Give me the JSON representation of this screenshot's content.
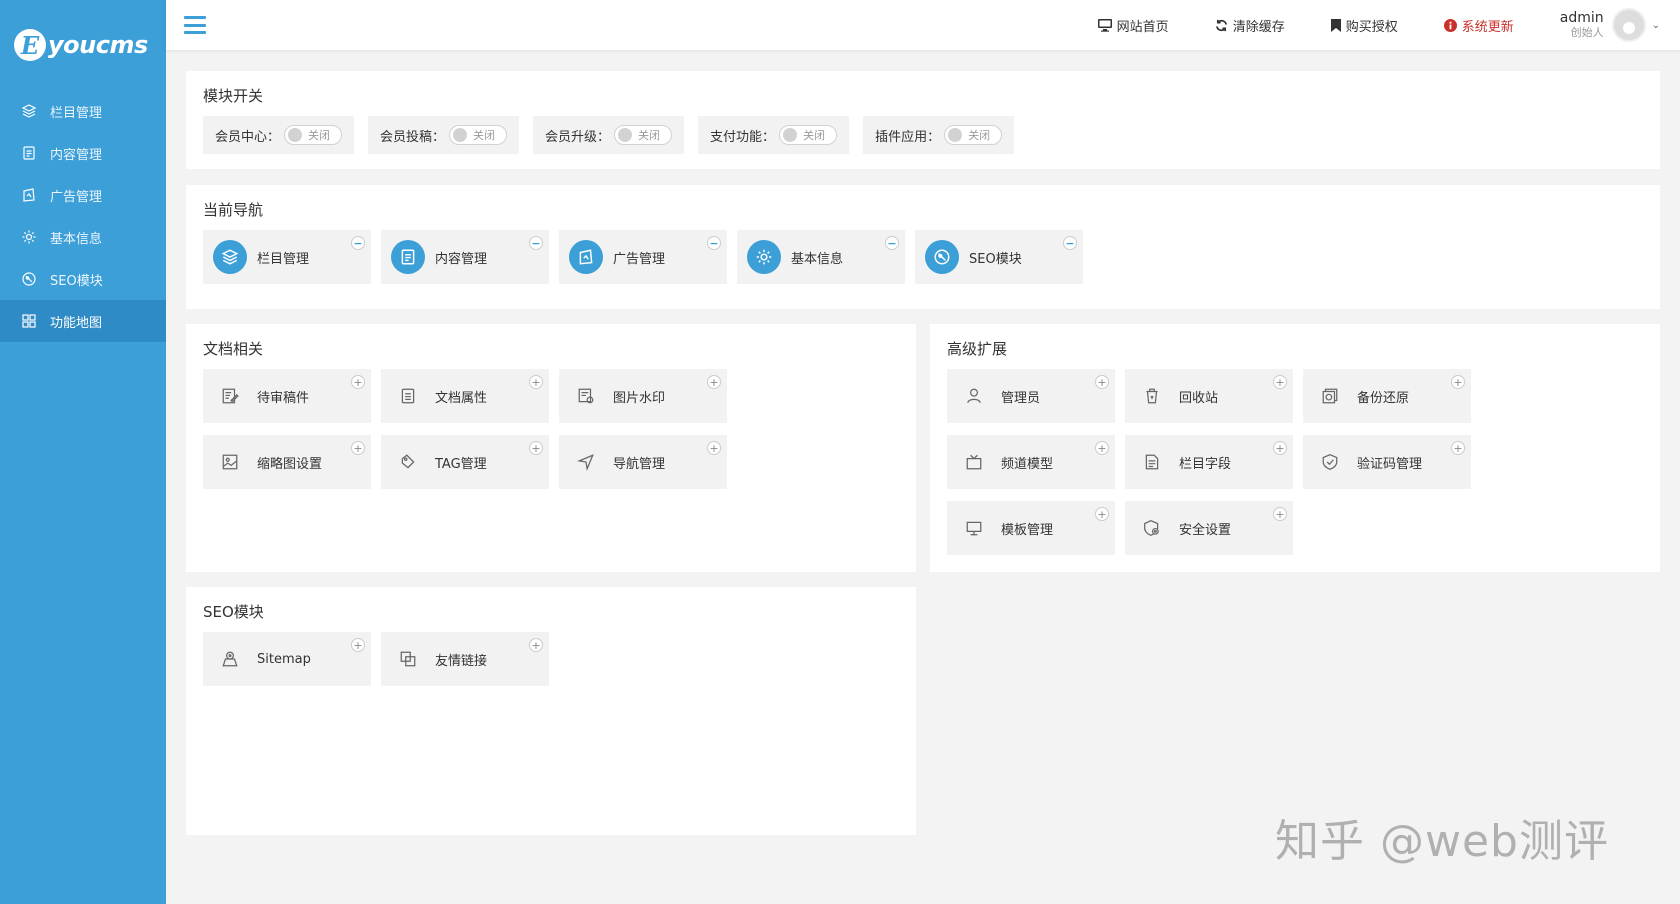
{
  "brand": {
    "logo_letter": "E",
    "logo_text": "youcms"
  },
  "sidebar": {
    "items": [
      {
        "label": "栏目管理",
        "icon": "layers-icon"
      },
      {
        "label": "内容管理",
        "icon": "document-icon"
      },
      {
        "label": "广告管理",
        "icon": "ad-icon"
      },
      {
        "label": "基本信息",
        "icon": "gear-icon"
      },
      {
        "label": "SEO模块",
        "icon": "seo-icon"
      },
      {
        "label": "功能地图",
        "icon": "grid-icon",
        "active": true
      }
    ]
  },
  "header": {
    "links": [
      {
        "label": "网站首页",
        "icon": "monitor-icon"
      },
      {
        "label": "清除缓存",
        "icon": "refresh-icon"
      },
      {
        "label": "购买授权",
        "icon": "bookmark-icon"
      },
      {
        "label": "系统更新",
        "icon": "info-icon",
        "color": "#c9302c"
      }
    ],
    "user": {
      "name": "admin",
      "role": "创始人"
    }
  },
  "module_switch": {
    "title": "模块开关",
    "items": [
      {
        "label": "会员中心：",
        "state": "关闭"
      },
      {
        "label": "会员投稿：",
        "state": "关闭"
      },
      {
        "label": "会员升级：",
        "state": "关闭"
      },
      {
        "label": "支付功能：",
        "state": "关闭"
      },
      {
        "label": "插件应用：",
        "state": "关闭"
      }
    ]
  },
  "current_nav": {
    "title": "当前导航",
    "items": [
      {
        "label": "栏目管理",
        "icon": "layers-icon",
        "badge": "−"
      },
      {
        "label": "内容管理",
        "icon": "document-icon",
        "badge": "−"
      },
      {
        "label": "广告管理",
        "icon": "ad-icon",
        "badge": "−"
      },
      {
        "label": "基本信息",
        "icon": "gear-icon",
        "badge": "−"
      },
      {
        "label": "SEO模块",
        "icon": "seo-icon",
        "badge": "−"
      }
    ]
  },
  "doc_related": {
    "title": "文档相关",
    "items": [
      {
        "label": "待审稿件",
        "icon": "edit-icon",
        "badge": "+"
      },
      {
        "label": "文档属性",
        "icon": "list-doc-icon",
        "badge": "+"
      },
      {
        "label": "图片水印",
        "icon": "watermark-icon",
        "badge": "+"
      },
      {
        "label": "缩略图设置",
        "icon": "image-icon",
        "badge": "+"
      },
      {
        "label": "TAG管理",
        "icon": "tag-icon",
        "badge": "+"
      },
      {
        "label": "导航管理",
        "icon": "navigation-icon",
        "badge": "+"
      }
    ]
  },
  "advanced": {
    "title": "高级扩展",
    "items": [
      {
        "label": "管理员",
        "icon": "user-icon",
        "badge": "+"
      },
      {
        "label": "回收站",
        "icon": "trash-icon",
        "badge": "+"
      },
      {
        "label": "备份还原",
        "icon": "backup-icon",
        "badge": "+"
      },
      {
        "label": "频道模型",
        "icon": "tv-icon",
        "badge": "+"
      },
      {
        "label": "栏目字段",
        "icon": "field-icon",
        "badge": "+"
      },
      {
        "label": "验证码管理",
        "icon": "shield-icon",
        "badge": "+"
      },
      {
        "label": "模板管理",
        "icon": "monitor-icon",
        "badge": "+"
      },
      {
        "label": "安全设置",
        "icon": "security-icon",
        "badge": "+"
      }
    ]
  },
  "seo_module": {
    "title": "SEO模块",
    "items": [
      {
        "label": "Sitemap",
        "icon": "map-pin-icon",
        "badge": "+"
      },
      {
        "label": "友情链接",
        "icon": "link-icon",
        "badge": "+"
      }
    ]
  },
  "watermark": "知乎 @web测评",
  "colors": {
    "primary": "#3c9fd8",
    "sidebar_active": "#2f8bc5",
    "update": "#c9302c",
    "card_bg": "#f2f2f2"
  }
}
